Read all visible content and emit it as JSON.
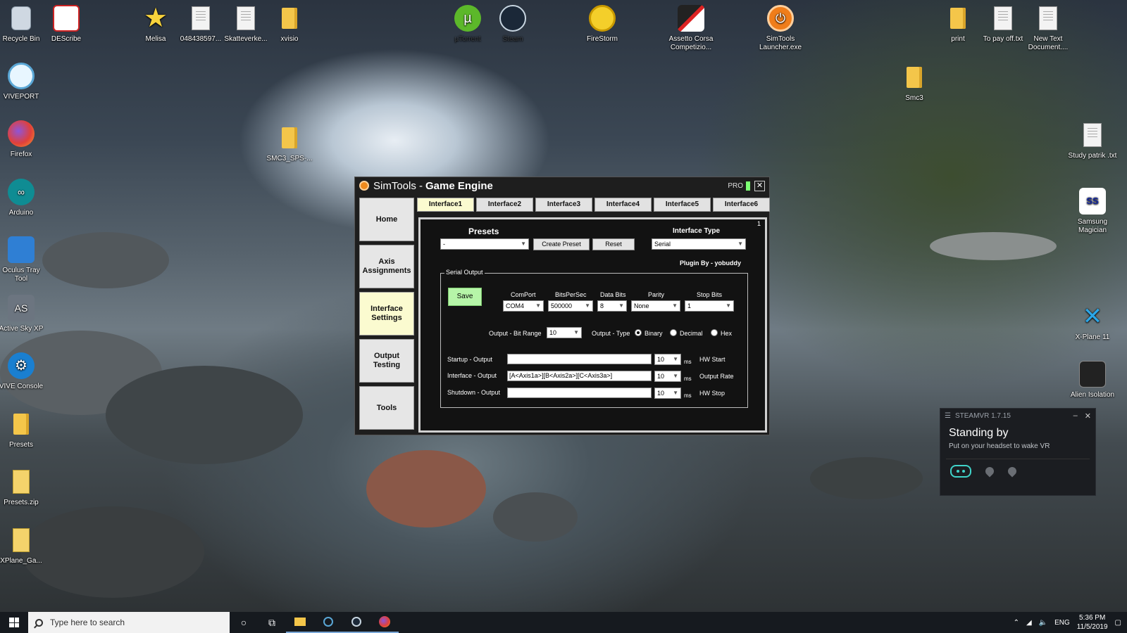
{
  "desktop": {
    "icons_left": [
      {
        "label": "Recycle Bin",
        "icon": "recycle-bin-icon"
      },
      {
        "label": "VIVEPORT",
        "icon": "viveport-icon"
      },
      {
        "label": "Firefox",
        "icon": "firefox-icon"
      },
      {
        "label": "Arduino",
        "icon": "arduino-icon"
      },
      {
        "label": "Oculus Tray Tool",
        "icon": "oculus-tray-tool-icon"
      },
      {
        "label": "Active Sky XP",
        "icon": "active-sky-icon"
      },
      {
        "label": "VIVE Console",
        "icon": "vive-console-icon"
      },
      {
        "label": "Presets",
        "icon": "folder-icon"
      },
      {
        "label": "Presets.zip",
        "icon": "zip-folder-icon"
      },
      {
        "label": "XPlane_Ga...",
        "icon": "zip-folder-icon"
      }
    ],
    "icons_top": [
      {
        "label": "DEScribe",
        "icon": "describe-icon"
      },
      {
        "label": "Melisa",
        "icon": "star-icon"
      },
      {
        "label": "048438597...",
        "icon": "document-icon"
      },
      {
        "label": "Skatteverke...",
        "icon": "document-icon"
      },
      {
        "label": "xvisio",
        "icon": "folder-icon"
      },
      {
        "label": "SMC3_SPS-...",
        "icon": "folder-icon"
      },
      {
        "label": "µTorrent",
        "icon": "utorrent-icon"
      },
      {
        "label": "Steam",
        "icon": "steam-icon"
      },
      {
        "label": "FireStorm",
        "icon": "firestorm-icon"
      },
      {
        "label": "Assetto Corsa Competizio...",
        "icon": "assetto-corsa-icon"
      },
      {
        "label": "SimTools Launcher.exe",
        "icon": "simtools-launcher-icon"
      }
    ],
    "icons_right": [
      {
        "label": "print",
        "icon": "folder-icon"
      },
      {
        "label": "To pay off.txt",
        "icon": "document-icon"
      },
      {
        "label": "New Text Document....",
        "icon": "document-icon"
      },
      {
        "label": "Smc3",
        "icon": "folder-icon"
      },
      {
        "label": "Study patrik .txt",
        "icon": "document-icon"
      },
      {
        "label": "Samsung Magician",
        "icon": "samsung-magician-icon"
      },
      {
        "label": "X-Plane 11",
        "icon": "xplane-icon"
      },
      {
        "label": "Alien Isolation",
        "icon": "alien-isolation-icon"
      }
    ]
  },
  "window": {
    "title_part1": "SimTools - ",
    "title_part2": "Game Engine",
    "pro_label": "PRO",
    "close_glyph": "✕",
    "nav": [
      "Home",
      "Axis Assignments",
      "Interface Settings",
      "Output Testing",
      "Tools"
    ],
    "tabs": [
      "Interface1",
      "Interface2",
      "Interface3",
      "Interface4",
      "Interface5",
      "Interface6"
    ],
    "panel": {
      "corner_number": "1",
      "presets_label": "Presets",
      "presets_value": "-",
      "create_preset": "Create Preset",
      "reset": "Reset",
      "interface_type_label": "Interface Type",
      "interface_type_value": "Serial",
      "plugin_by": "Plugin By - yobuddy",
      "serial_output_legend": "Serial Output",
      "save": "Save",
      "comport_label": "ComPort",
      "comport_value": "COM4",
      "bitspersec_label": "BitsPerSec",
      "bitspersec_value": "500000",
      "databits_label": "Data Bits",
      "databits_value": "8",
      "parity_label": "Parity",
      "parity_value": "None",
      "stopbits_label": "Stop Bits",
      "stopbits_value": "1",
      "bitrange_label": "Output - Bit Range",
      "bitrange_value": "10",
      "outputtype_label": "Output - Type",
      "type_binary": "Binary",
      "type_decimal": "Decimal",
      "type_hex": "Hex",
      "startup_label": "Startup - Output",
      "startup_value": "",
      "startup_ms": "10",
      "hw_start": "HW Start",
      "interface_label": "Interface - Output",
      "interface_value": "[A<Axis1a>][B<Axis2a>][C<Axis3a>]",
      "interface_ms": "10",
      "output_rate": "Output Rate",
      "shutdown_label": "Shutdown - Output",
      "shutdown_value": "",
      "shutdown_ms": "10",
      "hw_stop": "HW Stop",
      "ms_unit": "ms"
    }
  },
  "steamvr": {
    "title": "STEAMVR 1.7.15",
    "status": "Standing by",
    "subtitle": "Put on your headset to wake VR"
  },
  "taskbar": {
    "search_placeholder": "Type here to search",
    "language": "ENG",
    "time": "5:36 PM",
    "date": "11/5/2019"
  }
}
